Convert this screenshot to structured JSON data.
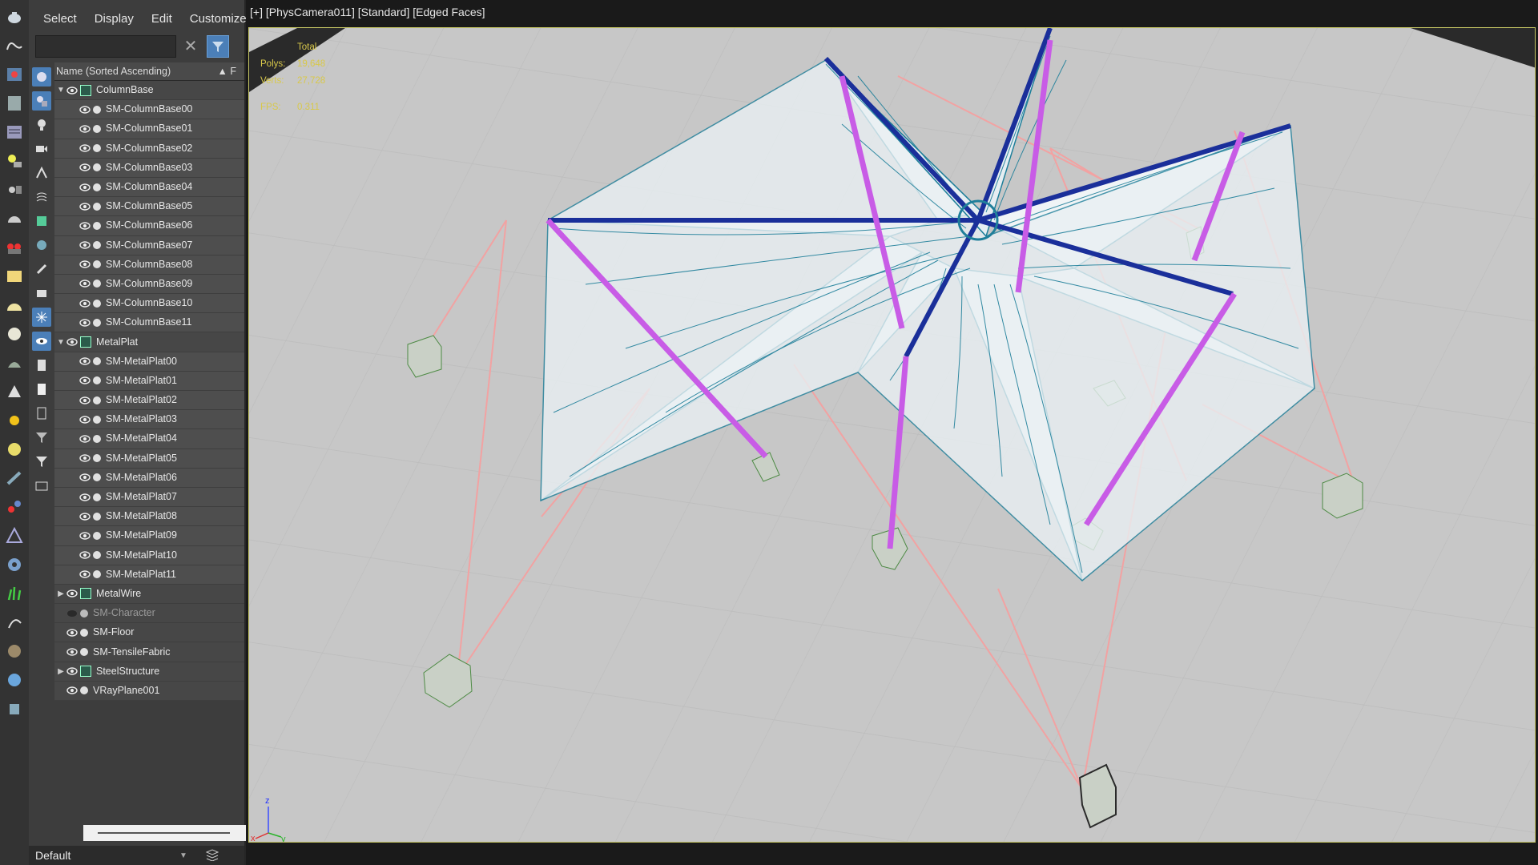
{
  "menu": {
    "items": [
      "Select",
      "Display",
      "Edit",
      "Customize"
    ]
  },
  "search": {
    "placeholder": ""
  },
  "tree": {
    "header": "Name (Sorted Ascending)",
    "sort_indicator": "▲ F",
    "rows": [
      {
        "label": "ColumnBase",
        "kind": "group",
        "expanded": true,
        "visible": true
      },
      {
        "label": "SM-ColumnBase00",
        "kind": "child",
        "visible": true
      },
      {
        "label": "SM-ColumnBase01",
        "kind": "child",
        "visible": true
      },
      {
        "label": "SM-ColumnBase02",
        "kind": "child",
        "visible": true
      },
      {
        "label": "SM-ColumnBase03",
        "kind": "child",
        "visible": true
      },
      {
        "label": "SM-ColumnBase04",
        "kind": "child",
        "visible": true
      },
      {
        "label": "SM-ColumnBase05",
        "kind": "child",
        "visible": true
      },
      {
        "label": "SM-ColumnBase06",
        "kind": "child",
        "visible": true
      },
      {
        "label": "SM-ColumnBase07",
        "kind": "child",
        "visible": true
      },
      {
        "label": "SM-ColumnBase08",
        "kind": "child",
        "visible": true
      },
      {
        "label": "SM-ColumnBase09",
        "kind": "child",
        "visible": true
      },
      {
        "label": "SM-ColumnBase10",
        "kind": "child",
        "visible": true
      },
      {
        "label": "SM-ColumnBase11",
        "kind": "child",
        "visible": true
      },
      {
        "label": "MetalPlat",
        "kind": "group",
        "expanded": true,
        "visible": true
      },
      {
        "label": "SM-MetalPlat00",
        "kind": "child",
        "visible": true
      },
      {
        "label": "SM-MetalPlat01",
        "kind": "child",
        "visible": true
      },
      {
        "label": "SM-MetalPlat02",
        "kind": "child",
        "visible": true
      },
      {
        "label": "SM-MetalPlat03",
        "kind": "child",
        "visible": true
      },
      {
        "label": "SM-MetalPlat04",
        "kind": "child",
        "visible": true
      },
      {
        "label": "SM-MetalPlat05",
        "kind": "child",
        "visible": true
      },
      {
        "label": "SM-MetalPlat06",
        "kind": "child",
        "visible": true
      },
      {
        "label": "SM-MetalPlat07",
        "kind": "child",
        "visible": true
      },
      {
        "label": "SM-MetalPlat08",
        "kind": "child",
        "visible": true
      },
      {
        "label": "SM-MetalPlat09",
        "kind": "child",
        "visible": true
      },
      {
        "label": "SM-MetalPlat10",
        "kind": "child",
        "visible": true
      },
      {
        "label": "SM-MetalPlat11",
        "kind": "child",
        "visible": true
      },
      {
        "label": "MetalWire",
        "kind": "group",
        "expanded": false,
        "visible": true
      },
      {
        "label": "SM-Character",
        "kind": "object",
        "visible": false
      },
      {
        "label": "SM-Floor",
        "kind": "object",
        "visible": true
      },
      {
        "label": "SM-TensileFabric",
        "kind": "object",
        "visible": true
      },
      {
        "label": "SteelStructure",
        "kind": "group",
        "expanded": false,
        "visible": true
      },
      {
        "label": "VRayPlane001",
        "kind": "object",
        "visible": true
      }
    ]
  },
  "layer": {
    "name": "Default"
  },
  "viewport": {
    "label": "[+] [PhysCamera011] [Standard] [Edged Faces]",
    "stats": {
      "total_label": "Total",
      "polys_label": "Polys:",
      "polys": "19,648",
      "verts_label": "Verts:",
      "verts": "27,728",
      "fps_label": "FPS:",
      "fps": "0.311"
    },
    "axis": {
      "z": "z",
      "x": "x",
      "y": "y"
    }
  },
  "colors": {
    "fabric_wire": "#1f7f9a",
    "beam": "#1a2f9a",
    "column": "#c85ce6",
    "cable": "#f0a0a0",
    "base": "#c8d0c4",
    "floor": "#c9c9c9",
    "stats": "#d8c84a"
  },
  "icons": [
    "teapot-icon",
    "sphere-icon",
    "cone-icon",
    "camera-icon",
    "light-icon",
    "helper-icon",
    "shape-icon",
    "system-icon"
  ]
}
